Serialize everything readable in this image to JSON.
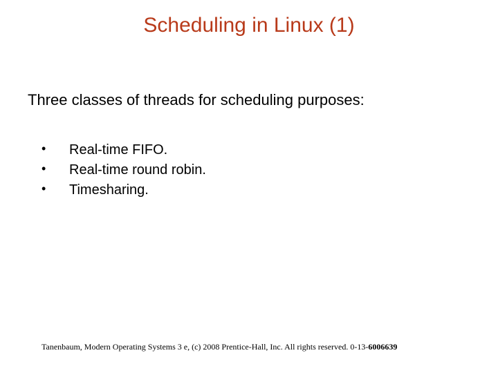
{
  "title": "Scheduling in Linux (1)",
  "intro": "Three classes of threads for scheduling purposes:",
  "bullets": [
    "Real-time FIFO.",
    "Real-time round robin.",
    "Timesharing."
  ],
  "footer": {
    "prefix": "Tanenbaum, Modern Operating Systems 3 e, (c) 2008 Prentice-Hall, Inc. All rights reserved. 0-13-",
    "suffix": "6006639"
  }
}
